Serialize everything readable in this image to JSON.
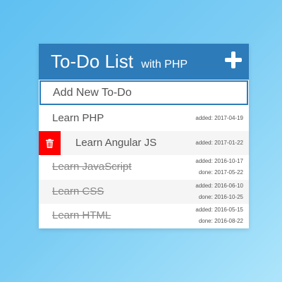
{
  "header": {
    "title": "To-Do List",
    "subtitle": "with PHP",
    "add_icon": "plus-icon"
  },
  "new_todo": {
    "placeholder": "Add New To-Do",
    "value": ""
  },
  "todos": [
    {
      "label": "Learn PHP",
      "added": "added: 2017-04-19",
      "done": "",
      "completed": false
    },
    {
      "label": "Learn Angular JS",
      "added": "added: 2017-01-22",
      "done": "",
      "completed": false,
      "hover_delete": true,
      "delete_icon": "trash-icon"
    },
    {
      "label": "Learn JavaScript",
      "added": "added: 2016-10-17",
      "done": "done: 2017-05-22",
      "completed": true
    },
    {
      "label": "Learn CSS",
      "added": "added: 2016-06-10",
      "done": "done: 2016-10-25",
      "completed": true
    },
    {
      "label": "Learn HTML",
      "added": "added: 2016-05-15",
      "done": "done: 2016-08-22",
      "completed": true
    }
  ],
  "colors": {
    "header": "#2d7bb8",
    "delete": "#ff0000",
    "background_start": "#5fc0f1",
    "background_end": "#ade5fb"
  }
}
